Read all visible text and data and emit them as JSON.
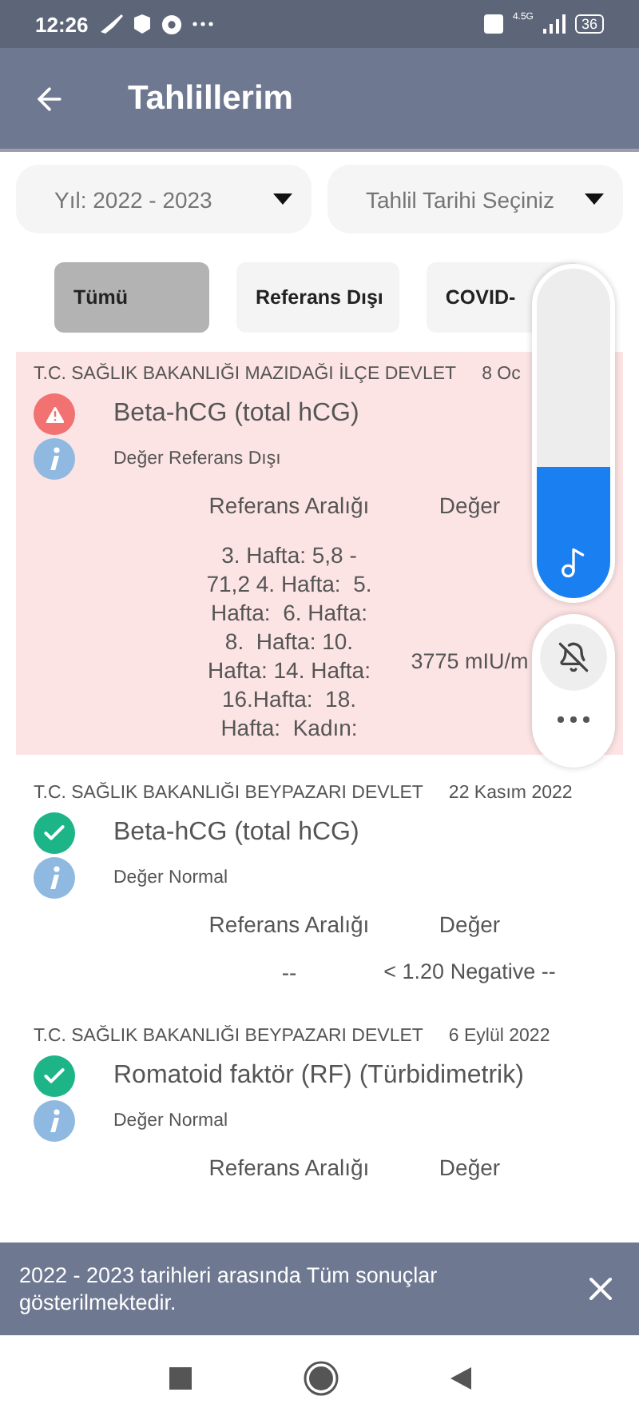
{
  "status_bar": {
    "time": "12:26",
    "network": "4.5G",
    "battery": "36"
  },
  "app_bar": {
    "title": "Tahlillerim"
  },
  "filters": [
    {
      "label": "Yıl: 2022 - 2023"
    },
    {
      "label": "Tahlil Tarihi Seçiniz"
    }
  ],
  "tabs": [
    {
      "label": "Tümü",
      "selected": true
    },
    {
      "label": "Referans Dışı",
      "selected": false
    },
    {
      "label": "COVID-",
      "selected": false
    }
  ],
  "results": [
    {
      "institution": "T.C. SAĞLIK BAKANLIĞI MAZIDAĞI İLÇE DEVLET",
      "date": "8 Oc",
      "kind": "abnormal",
      "test": "Beta-hCG (total hCG)",
      "status_text": "Değer Referans Dışı",
      "range_heading": "Referans Aralığı",
      "value_heading": "Değer",
      "range": "3. Hafta: 5,8 - 71,2 4. Hafta:  5. Hafta:  6. Hafta: 8.  Hafta: 10. Hafta: 14. Hafta: 16.Hafta:  18. Hafta:  Kadın:",
      "value": "3775 mIU/m"
    },
    {
      "institution": "T.C. SAĞLIK BAKANLIĞI BEYPAZARI DEVLET",
      "date": "22 Kasım 2022",
      "kind": "normal",
      "test": "Beta-hCG (total hCG)",
      "status_text": "Değer Normal",
      "range_heading": "Referans Aralığı",
      "value_heading": "Değer",
      "range": "--",
      "value": "< 1.20 Negative --"
    },
    {
      "institution": "T.C. SAĞLIK BAKANLIĞI BEYPAZARI DEVLET",
      "date": "6 Eylül 2022",
      "kind": "normal",
      "test": "Romatoid faktör (RF) (Türbidimetrik)",
      "status_text": "Değer Normal",
      "range_heading": "Referans Aralığı",
      "value_heading": "Değer"
    }
  ],
  "volume": {
    "level": 0.4
  },
  "snackbar": {
    "message": "2022 - 2023 tarihleri arasında Tüm sonuçlar gösterilmektedir."
  }
}
